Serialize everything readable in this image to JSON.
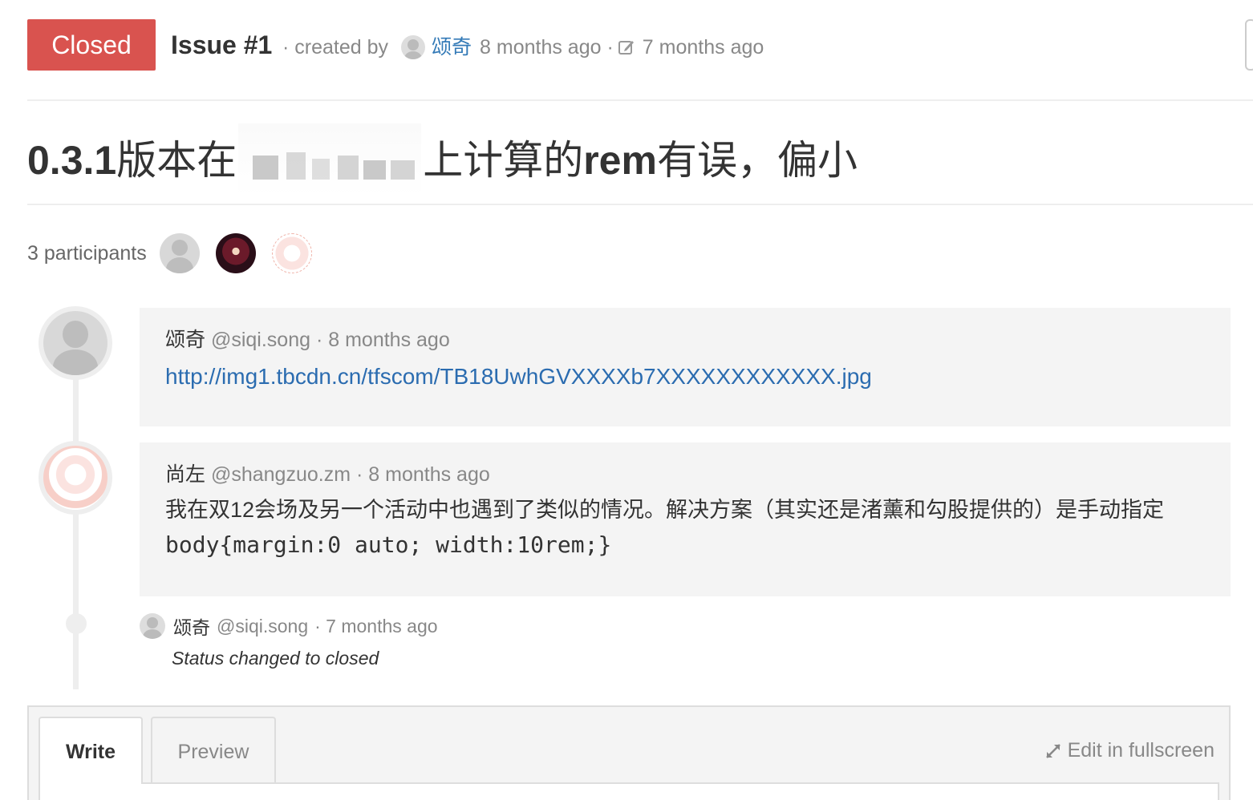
{
  "header": {
    "status_label": "Closed",
    "issue_number": "Issue #1",
    "created_by_text": "· created by",
    "author": "颂奇",
    "created_time": "8 months ago ·",
    "edited_time": "7 months ago"
  },
  "issue": {
    "title_prefix": "0.3.1",
    "title_part1": "版本在",
    "title_part2": "上计算的",
    "title_rem": "rem",
    "title_part3": "有误，偏小"
  },
  "participants": {
    "label": "3 participants"
  },
  "comments": [
    {
      "name": "颂奇",
      "handle": "@siqi.song",
      "time": "· 8 months ago",
      "link": "http://img1.tbcdn.cn/tfscom/TB18UwhGVXXXXb7XXXXXXXXXXXX.jpg"
    },
    {
      "name": "尚左",
      "handle": "@shangzuo.zm",
      "time": "· 8 months ago",
      "body_text": "我在双12会场及另一个活动中也遇到了类似的情况。解决方案（其实还是渚薰和勾股提供的）是手动指定",
      "body_code": "body{margin:0 auto; width:10rem;}"
    }
  ],
  "event": {
    "name": "颂奇",
    "handle": "@siqi.song",
    "time": "· 7 months ago",
    "status_text": "Status changed to closed"
  },
  "editor": {
    "tab_write": "Write",
    "tab_preview": "Preview",
    "fullscreen_label": "Edit in fullscreen"
  },
  "colors": {
    "closed_badge": "#d9534f",
    "link": "#337ab7"
  }
}
